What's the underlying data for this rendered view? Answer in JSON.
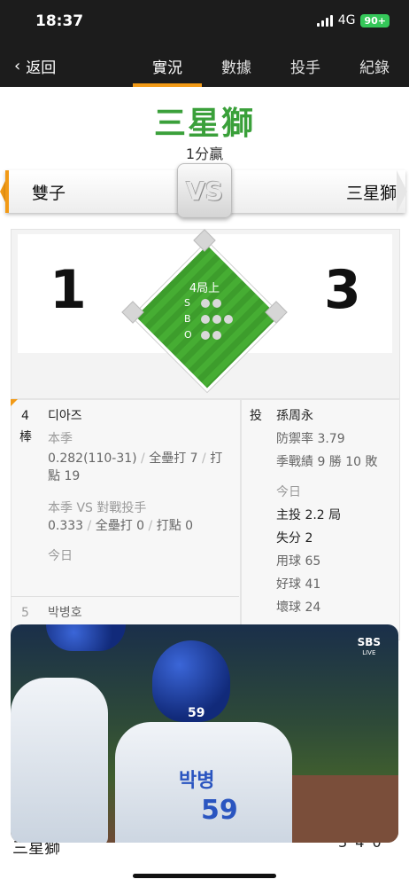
{
  "status": {
    "time": "18:37",
    "network": "4G",
    "battery": "90+"
  },
  "nav": {
    "back_label": "返回",
    "tabs": [
      {
        "label": "實況"
      },
      {
        "label": "數據"
      },
      {
        "label": "投手"
      },
      {
        "label": "紀錄"
      }
    ],
    "active_tab": "實況"
  },
  "header": {
    "winner": "三星獅",
    "margin": "1分贏"
  },
  "teams": {
    "away": "雙子",
    "home": "三星獅",
    "vs_label": "VS"
  },
  "score": {
    "away": "1",
    "home": "3",
    "inning": "4局上"
  },
  "count": {
    "labels": {
      "s": "S",
      "b": "B",
      "o": "O"
    },
    "strikes": 0,
    "balls": 0,
    "outs": 0
  },
  "batter": {
    "order": "4",
    "order_suffix": "棒",
    "name": "디아즈",
    "season_label": "本季",
    "season_avg": "0.282(110-31)",
    "season_hr": "全壘打 7",
    "season_rbi_a": "打",
    "season_rbi_b": "點 19",
    "vs_label": "本季 VS 對戰投手",
    "vs_avg": "0.333",
    "vs_hr": "全壘打 0",
    "vs_rbi": "打點 0",
    "today_label": "今日"
  },
  "next_batter": {
    "order": "5",
    "name": "박병호"
  },
  "pitcher": {
    "label": "投",
    "name": "孫周永",
    "era": "防禦率 3.79",
    "record": "季戰績 9 勝 10 敗",
    "today_label": "今日",
    "innings": "主投 2.2 局",
    "runs": "失分 2",
    "pitches": "用球 65",
    "strikes": "好球 41",
    "balls": "壞球 24"
  },
  "linescore": {
    "team": "三星獅",
    "values": "3 4 0"
  },
  "video": {
    "broadcaster": "SBS",
    "live_label": "LIVE",
    "jersey_numbers": [
      "59",
      "59"
    ],
    "jersey_letters": "박병"
  }
}
